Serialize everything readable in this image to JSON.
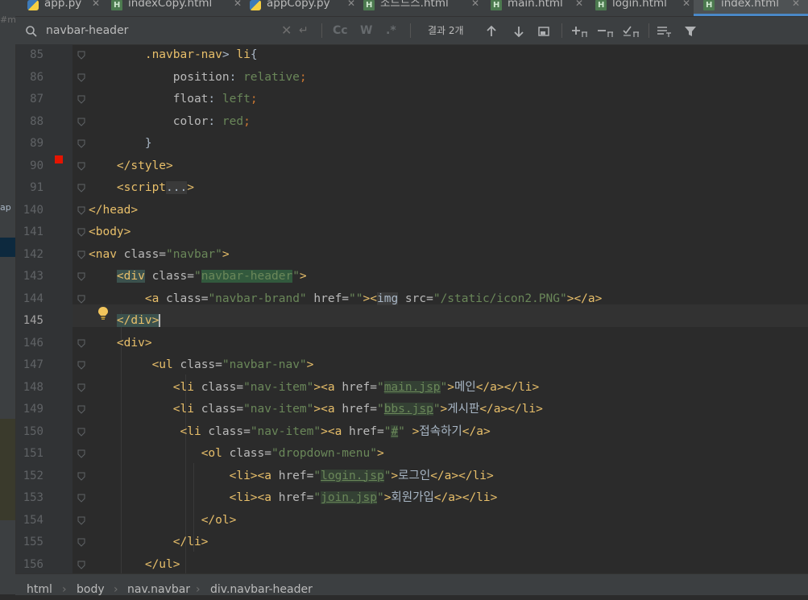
{
  "tabs": [
    {
      "label": "app.py",
      "type": "py"
    },
    {
      "label": "indexCopy.html",
      "type": "html"
    },
    {
      "label": "appCopy.py",
      "type": "py"
    },
    {
      "label": "소드드스.html",
      "type": "html"
    },
    {
      "label": "main.html",
      "type": "html"
    },
    {
      "label": "login.html",
      "type": "html"
    },
    {
      "label": "index.html",
      "type": "html"
    }
  ],
  "leftpanel": {
    "text_top": "#m",
    "text_mid": "ap"
  },
  "search": {
    "query": "navbar-header",
    "result_count": "결과 2개",
    "match_case": "Cc",
    "words": "W",
    "regex": ".*"
  },
  "gutter": {
    "lines": [
      "85",
      "86",
      "87",
      "88",
      "89",
      "90",
      "91",
      "140",
      "141",
      "142",
      "143",
      "144",
      "145",
      "146",
      "147",
      "148",
      "149",
      "150",
      "151",
      "152",
      "153",
      "154",
      "155",
      "156"
    ]
  },
  "code": [
    {
      "indent": "        ",
      "parts": [
        [
          "sel-css",
          ".navbar-nav"
        ],
        [
          "",
          "> "
        ],
        [
          "sel-css",
          "li"
        ],
        [
          "",
          "{"
        ]
      ]
    },
    {
      "indent": "            ",
      "parts": [
        [
          "prop",
          "position"
        ],
        [
          "",
          ": "
        ],
        [
          "str",
          "relative"
        ],
        [
          "kw",
          ";"
        ]
      ]
    },
    {
      "indent": "            ",
      "parts": [
        [
          "prop",
          "float"
        ],
        [
          "",
          ": "
        ],
        [
          "str",
          "left"
        ],
        [
          "kw",
          ";"
        ]
      ]
    },
    {
      "indent": "            ",
      "parts": [
        [
          "prop",
          "color"
        ],
        [
          "",
          ": "
        ],
        [
          "str",
          "red"
        ],
        [
          "kw",
          ";"
        ]
      ]
    },
    {
      "indent": "        ",
      "parts": [
        [
          "",
          "}"
        ]
      ]
    },
    {
      "indent": "    ",
      "parts": [
        [
          "tag",
          "</style>"
        ]
      ]
    },
    {
      "indent": "    ",
      "parts": [
        [
          "tag",
          "<script"
        ],
        [
          "fold-h",
          "..."
        ],
        [
          "tag",
          ">"
        ]
      ]
    },
    {
      "indent": "",
      "parts": [
        [
          "tag",
          "</head>"
        ]
      ]
    },
    {
      "indent": "",
      "parts": [
        [
          "tag",
          "<body>"
        ]
      ]
    },
    {
      "indent": "",
      "parts": [
        [
          "tag",
          "<nav "
        ],
        [
          "att",
          "class="
        ],
        [
          "str",
          "\"navbar\""
        ],
        [
          "tag",
          ">"
        ]
      ]
    },
    {
      "indent": "    ",
      "parts": [
        [
          "tag hl2",
          "<div"
        ],
        [
          "att",
          " class="
        ],
        [
          "str",
          "\""
        ],
        [
          "str hl",
          "navbar-header"
        ],
        [
          "str",
          "\""
        ],
        [
          "tag",
          ">"
        ]
      ]
    },
    {
      "indent": "        ",
      "parts": [
        [
          "tag",
          "<a "
        ],
        [
          "att",
          "class="
        ],
        [
          "str",
          "\"navbar-brand\" "
        ],
        [
          "att",
          "href="
        ],
        [
          "str",
          "\"\""
        ],
        [
          "tag",
          "><"
        ],
        [
          "tag fold-h",
          "img"
        ],
        [
          "att",
          " src="
        ],
        [
          "str",
          "\"/static/icon2.PNG\""
        ],
        [
          "tag",
          "></a>"
        ]
      ]
    },
    {
      "indent": "    ",
      "parts": [
        [
          "tag hl2",
          "</div>"
        ],
        [
          "caret",
          ""
        ]
      ]
    },
    {
      "indent": "    ",
      "parts": [
        [
          "tag",
          "<div>"
        ]
      ]
    },
    {
      "indent": "         ",
      "parts": [
        [
          "tag",
          "<ul "
        ],
        [
          "att",
          "class="
        ],
        [
          "str",
          "\"navbar-nav\""
        ],
        [
          "tag",
          ">"
        ]
      ]
    },
    {
      "indent": "            ",
      "parts": [
        [
          "tag",
          "<li "
        ],
        [
          "att",
          "class="
        ],
        [
          "str",
          "\"nav-item\""
        ],
        [
          "tag",
          "><a "
        ],
        [
          "att",
          "href="
        ],
        [
          "str",
          "\""
        ],
        [
          "usage",
          "main.jsp"
        ],
        [
          "str",
          "\""
        ],
        [
          "tag",
          ">"
        ],
        [
          "",
          "메인"
        ],
        [
          "tag",
          "</a></li>"
        ]
      ]
    },
    {
      "indent": "            ",
      "parts": [
        [
          "tag",
          "<li "
        ],
        [
          "att",
          "class="
        ],
        [
          "str",
          "\"nav-item\""
        ],
        [
          "tag",
          "><a "
        ],
        [
          "att",
          "href="
        ],
        [
          "str",
          "\""
        ],
        [
          "usage",
          "bbs.jsp"
        ],
        [
          "str",
          "\""
        ],
        [
          "tag",
          ">"
        ],
        [
          "",
          "게시판"
        ],
        [
          "tag",
          "</a></li>"
        ]
      ]
    },
    {
      "indent": "             ",
      "parts": [
        [
          "tag",
          "<li "
        ],
        [
          "att",
          "class="
        ],
        [
          "str",
          "\"nav-item\""
        ],
        [
          "tag",
          "><a "
        ],
        [
          "att",
          "href="
        ],
        [
          "str",
          "\""
        ],
        [
          "usage",
          "#"
        ],
        [
          "str",
          "\" "
        ],
        [
          "tag",
          ">"
        ],
        [
          "",
          "접속하기"
        ],
        [
          "tag",
          "</a>"
        ]
      ]
    },
    {
      "indent": "                ",
      "parts": [
        [
          "tag",
          "<ol "
        ],
        [
          "att",
          "class="
        ],
        [
          "str",
          "\"dropdown-menu\""
        ],
        [
          "tag",
          ">"
        ]
      ]
    },
    {
      "indent": "                    ",
      "parts": [
        [
          "tag",
          "<li><a "
        ],
        [
          "att",
          "href="
        ],
        [
          "str",
          "\""
        ],
        [
          "usage",
          "login.jsp"
        ],
        [
          "str",
          "\""
        ],
        [
          "tag",
          ">"
        ],
        [
          "",
          "로그인"
        ],
        [
          "tag",
          "</a></li>"
        ]
      ]
    },
    {
      "indent": "                    ",
      "parts": [
        [
          "tag",
          "<li><a "
        ],
        [
          "att",
          "href="
        ],
        [
          "str",
          "\""
        ],
        [
          "usage",
          "join.jsp"
        ],
        [
          "str",
          "\""
        ],
        [
          "tag",
          ">"
        ],
        [
          "",
          "회원가입"
        ],
        [
          "tag",
          "</a></li>"
        ]
      ]
    },
    {
      "indent": "                ",
      "parts": [
        [
          "tag",
          "</ol>"
        ]
      ]
    },
    {
      "indent": "            ",
      "parts": [
        [
          "tag",
          "</li>"
        ]
      ]
    },
    {
      "indent": "        ",
      "parts": [
        [
          "tag",
          "</ul>"
        ]
      ]
    }
  ],
  "current_line": "145",
  "breadcrumb": [
    "html",
    "body",
    "nav.navbar",
    "div.navbar-header"
  ]
}
